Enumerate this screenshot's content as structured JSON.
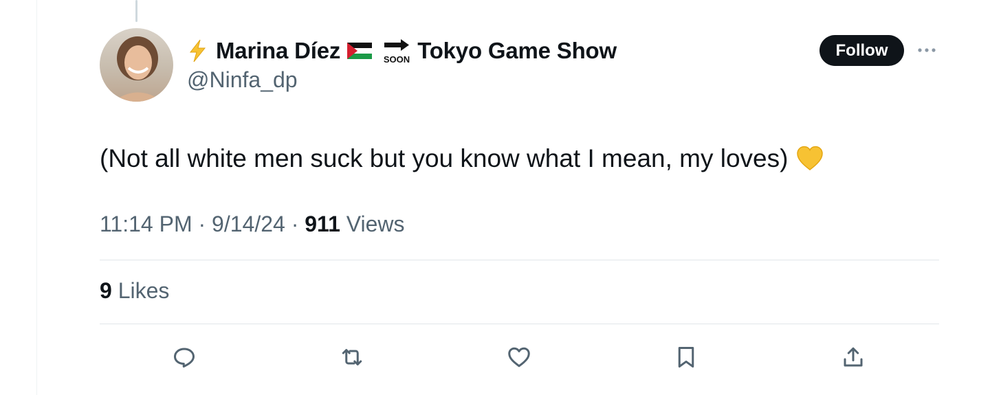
{
  "author": {
    "display_name": "Marina Díez",
    "flag": "Palestine flag",
    "soon_label": "SOON",
    "event_name": "Tokyo Game Show",
    "handle": "@Ninfa_dp"
  },
  "follow_label": "Follow",
  "tweet": {
    "text": "(Not all white men suck but you know what I mean, my loves)",
    "emoji": "yellow-heart"
  },
  "meta": {
    "time": "11:14 PM",
    "sep1": " · ",
    "date": "9/14/24",
    "sep2": " · ",
    "views_count": "911",
    "views_label": " Views"
  },
  "engagement": {
    "likes_count": "9",
    "likes_label": " Likes"
  },
  "actions": [
    "reply-icon",
    "retweet-icon",
    "like-icon",
    "bookmark-icon",
    "share-icon"
  ],
  "colors": {
    "text_primary": "#0f1419",
    "text_secondary": "#536471",
    "divider": "#e1e6e9",
    "follow_bg": "#0f1419",
    "emoji_heart": "#f7c233"
  }
}
